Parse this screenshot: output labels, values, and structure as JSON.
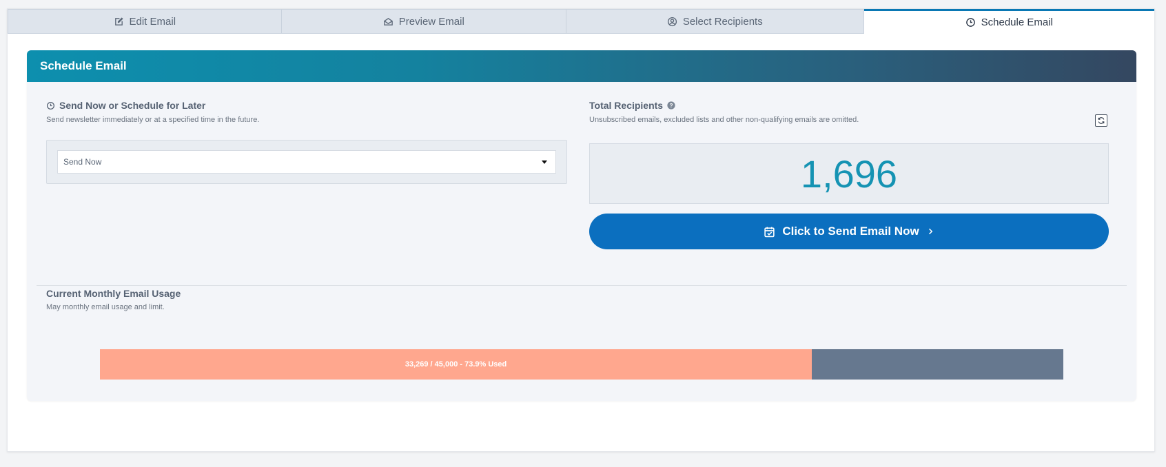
{
  "tabs": [
    {
      "label": "Edit Email",
      "icon": "edit-icon"
    },
    {
      "label": "Preview Email",
      "icon": "envelope-open-icon"
    },
    {
      "label": "Select Recipients",
      "icon": "user-circle-icon"
    },
    {
      "label": "Schedule Email",
      "icon": "clock-icon",
      "active": true
    }
  ],
  "panel": {
    "title": "Schedule Email"
  },
  "schedule": {
    "title": "Send Now or Schedule for Later",
    "description": "Send newsletter immediately or at a specified time in the future.",
    "selected_option": "Send Now"
  },
  "recipients": {
    "title": "Total Recipients",
    "description": "Unsubscribed emails, excluded lists and other non-qualifying emails are omitted.",
    "count": "1,696"
  },
  "send_button": {
    "label": "Click to Send Email Now"
  },
  "usage": {
    "title": "Current Monthly Email Usage",
    "description": "May monthly email usage and limit.",
    "label": "33,269 / 45,000 - 73.9% Used",
    "used_fraction": 0.739
  },
  "colors": {
    "accent": "#0b6fbf",
    "count": "#1593b3",
    "usage_used": "#ffa78e",
    "usage_remaining": "#66788f"
  }
}
